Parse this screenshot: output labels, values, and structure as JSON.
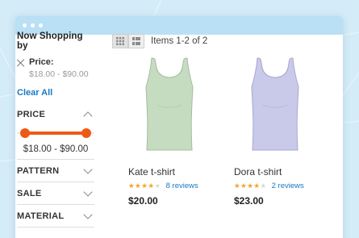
{
  "colors": {
    "background": "#d4ecf8",
    "titlebar": "#b9e0f4",
    "accent": "#ee5a16",
    "link": "#1979c3",
    "star": "#f5a623",
    "tank_1": "#c5dcc0",
    "tank_2": "#c9c9ea"
  },
  "sidebar": {
    "title": "Now Shopping by",
    "active_filter": {
      "name": "Price:",
      "value": "$18.00 - $90.00",
      "icon": "close-icon"
    },
    "clear_all": "Clear All",
    "price": {
      "label": "PRICE",
      "icon": "chevron-up-icon",
      "range_label": "$18.00 - $90.00",
      "slider_min_fraction": 0.1,
      "slider_max_fraction": 0.9
    },
    "facets": [
      {
        "label": "PATTERN",
        "icon": "chevron-down-icon"
      },
      {
        "label": "SALE",
        "icon": "chevron-down-icon"
      },
      {
        "label": "MATERIAL",
        "icon": "chevron-down-icon"
      }
    ]
  },
  "toolbar": {
    "modes": [
      {
        "name": "grid",
        "icon": "grid-view-icon",
        "active": true
      },
      {
        "name": "list",
        "icon": "list-view-icon",
        "active": false
      }
    ],
    "items_count": "Items 1-2 of 2"
  },
  "products": [
    {
      "name": "Kate t-shirt",
      "rating_fraction": 0.8,
      "reviews": "8 reviews",
      "price": "$20.00",
      "color": "#c5dcc0"
    },
    {
      "name": "Dora t-shirt",
      "rating_fraction": 0.8,
      "reviews": "2 reviews",
      "price": "$23.00",
      "color": "#c9c9ea"
    }
  ]
}
